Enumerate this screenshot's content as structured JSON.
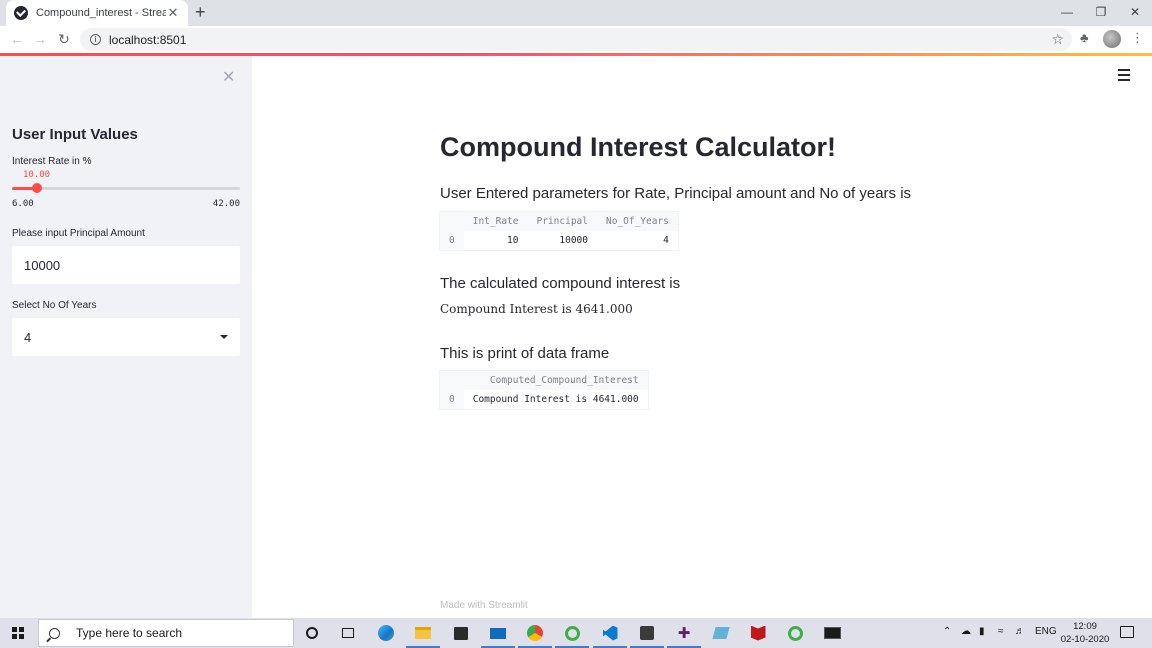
{
  "browser": {
    "tab_title": "Compound_interest - Streamlit",
    "tab_close": "✕",
    "new_tab": "+",
    "url": "localhost:8501"
  },
  "sidebar": {
    "title": "User Input Values",
    "rate_label": "Interest Rate in %",
    "rate_value": "10.00",
    "rate_min": "6.00",
    "rate_max": "42.00",
    "rate_fraction": 0.111,
    "principal_label": "Please input Principal Amount",
    "principal_value": "10000",
    "years_label": "Select No Of Years",
    "years_value": "4"
  },
  "main": {
    "title": "Compound Interest Calculator!",
    "params_heading": "User Entered parameters for Rate, Principal amount and No of years is",
    "params_table": {
      "columns": [
        "Int_Rate",
        "Principal",
        "No_Of_Years"
      ],
      "rows": [
        {
          "index": "0",
          "values": [
            "10",
            "10000",
            "4"
          ]
        }
      ]
    },
    "calc_heading": "The calculated compound interest is",
    "calc_text": "Compound Interest is 4641.000",
    "df_heading": "This is print of data frame",
    "df_table": {
      "columns": [
        "Computed_Compound_Interest"
      ],
      "rows": [
        {
          "index": "0",
          "values": [
            "Compound Interest is 4641.000"
          ]
        }
      ]
    },
    "footer": "Made with Streamlit"
  },
  "taskbar": {
    "search_placeholder": "Type here to search",
    "lang": "ENG",
    "time": "12:09",
    "date": "02-10-2020"
  },
  "colors": {
    "accent": "#ff4b4b",
    "sidebar_bg": "#f0f2f6"
  }
}
